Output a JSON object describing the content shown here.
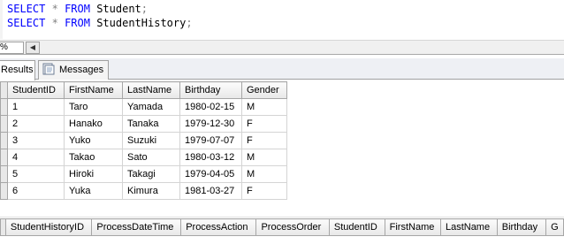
{
  "editor": {
    "line1": {
      "kw1": "SELECT",
      "star": "*",
      "kw2": "FROM",
      "table": "Student",
      "semi": ";"
    },
    "line2": {
      "kw1": "SELECT",
      "star": "*",
      "kw2": "FROM",
      "table": "StudentHistory",
      "semi": ";"
    }
  },
  "zoom": {
    "value": "%",
    "arrow": "◀"
  },
  "tabs": [
    {
      "label": "Results",
      "icon": "grid-icon"
    },
    {
      "label": "Messages",
      "icon": "messages-icon"
    }
  ],
  "student_grid": {
    "columns": [
      "StudentID",
      "FirstName",
      "LastName",
      "Birthday",
      "Gender"
    ],
    "rows": [
      [
        "1",
        "Taro",
        "Yamada",
        "1980-02-15",
        "M"
      ],
      [
        "2",
        "Hanako",
        "Tanaka",
        "1979-12-30",
        "F"
      ],
      [
        "3",
        "Yuko",
        "Suzuki",
        "1979-07-07",
        "F"
      ],
      [
        "4",
        "Takao",
        "Sato",
        "1980-03-12",
        "M"
      ],
      [
        "5",
        "Hiroki",
        "Takagi",
        "1979-04-05",
        "M"
      ],
      [
        "6",
        "Yuka",
        "Kimura",
        "1981-03-27",
        "F"
      ]
    ]
  },
  "history_grid": {
    "columns": [
      "StudentHistoryID",
      "ProcessDateTime",
      "ProcessAction",
      "ProcessOrder",
      "StudentID",
      "FirstName",
      "LastName",
      "Birthday",
      "G"
    ]
  },
  "colors": {
    "keyword": "#0000ff",
    "operator": "#808080"
  }
}
